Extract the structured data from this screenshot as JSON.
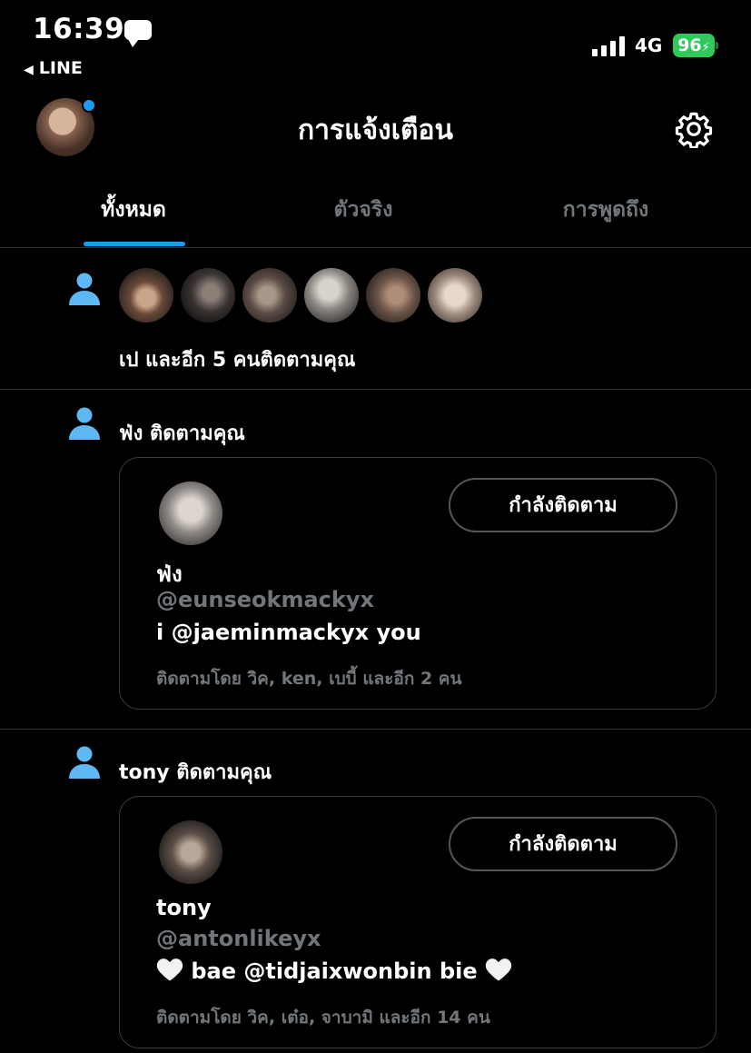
{
  "status_bar": {
    "time": "16:39",
    "back_app": "LINE",
    "network": "4G",
    "battery": "96"
  },
  "header": {
    "title": "การแจ้งเตือน"
  },
  "tabs": [
    {
      "label": "ทั้งหมด",
      "active": true
    },
    {
      "label": "ตัวจริง",
      "active": false
    },
    {
      "label": "การพูดถึง",
      "active": false
    }
  ],
  "notifications": [
    {
      "type": "group_follow",
      "text": "เป และอีก 5 คนติดตามคุณ",
      "avatar_count": 6
    },
    {
      "type": "follow",
      "text": "ฟ่ง ติดตามคุณ",
      "card": {
        "button_label": "กำลังติดตาม",
        "name": "ฟ่ง",
        "handle": "@eunseokmackyx",
        "bio": "i @jaeminmackyx you",
        "followed_by": "ติดตามโดย วิค, ken, เบบี้ และอีก 2 คน"
      }
    },
    {
      "type": "follow",
      "text": "tony ติดตามคุณ",
      "card": {
        "button_label": "กำลังติดตาม",
        "name": "tony",
        "handle": "@antonlikeyx",
        "bio": "bae @tidjaixwonbin bie",
        "followed_by": "ติดตามโดย วิค, เต๋อ, จาบามิ และอีก 14 คน"
      }
    }
  ],
  "colors": {
    "accent": "#1d9bf0",
    "person_icon": "#5eb8f5",
    "secondary_text": "#71767b",
    "battery": "#31c95b"
  }
}
